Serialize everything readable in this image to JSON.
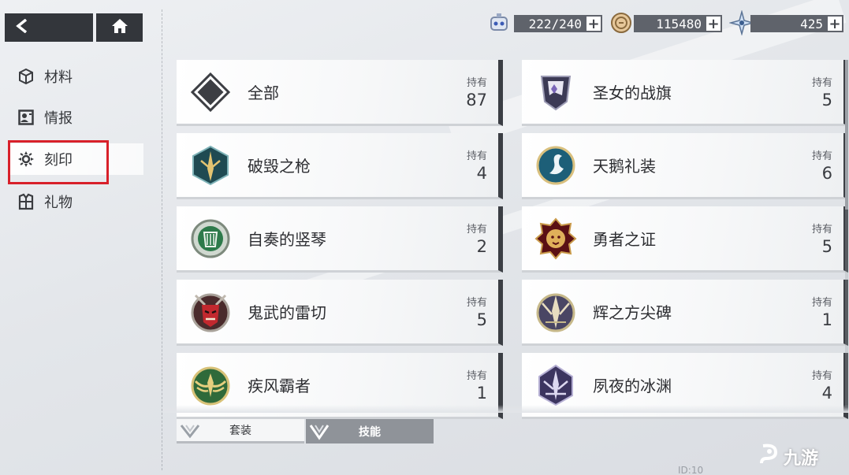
{
  "nav": {
    "back_icon": "back-arrow-icon",
    "home_icon": "home-icon"
  },
  "resources": [
    {
      "icon": "stamina-icon",
      "value": "222/240"
    },
    {
      "icon": "coin-icon",
      "value": "115480"
    },
    {
      "icon": "crystal-icon",
      "value": "425"
    }
  ],
  "sidebar": {
    "items": [
      {
        "label": "材料",
        "icon": "cube-icon"
      },
      {
        "label": "情报",
        "icon": "profile-card-icon"
      },
      {
        "label": "刻印",
        "icon": "rune-icon",
        "active": true
      },
      {
        "label": "礼物",
        "icon": "gift-icon"
      }
    ]
  },
  "owned_label": "持有",
  "cards": [
    {
      "name": "全部",
      "count": "87",
      "emblem": "diamond-grid-icon"
    },
    {
      "name": "圣女的战旗",
      "count": "5",
      "emblem": "banner-emblem-icon"
    },
    {
      "name": "破毁之枪",
      "count": "4",
      "emblem": "spear-emblem-icon"
    },
    {
      "name": "天鹅礼装",
      "count": "6",
      "emblem": "swan-emblem-icon"
    },
    {
      "name": "自奏的竖琴",
      "count": "2",
      "emblem": "harp-emblem-icon"
    },
    {
      "name": "勇者之证",
      "count": "5",
      "emblem": "lion-emblem-icon"
    },
    {
      "name": "鬼武的雷切",
      "count": "5",
      "emblem": "oni-mask-emblem-icon"
    },
    {
      "name": "辉之方尖碑",
      "count": "1",
      "emblem": "obelisk-emblem-icon"
    },
    {
      "name": "疾风霸者",
      "count": "1",
      "emblem": "wind-wings-emblem-icon"
    },
    {
      "name": "夙夜的冰渊",
      "count": "4",
      "emblem": "ice-abyss-emblem-icon"
    }
  ],
  "tabs": [
    {
      "label": "套装",
      "icon": "set-chevron-icon"
    },
    {
      "label": "技能",
      "icon": "skill-chevron-icon"
    }
  ],
  "footer": {
    "id_text": "ID:10",
    "watermark": "九游"
  },
  "colors": {
    "highlight_border": "#d8202a",
    "dark_panel": "#33363b"
  }
}
